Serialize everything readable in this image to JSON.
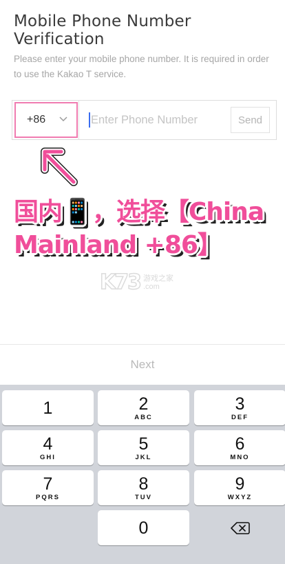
{
  "page": {
    "title": "Mobile Phone Number Verification",
    "description": "Please enter your mobile phone number. It is required in order to use the Kakao T service."
  },
  "phone_form": {
    "country_code": "+86",
    "placeholder": "Enter Phone Number",
    "send_label": "Send"
  },
  "annotation": {
    "line1": "国内📱，选择【China",
    "line2": "Mainland +86】",
    "color": "#f04e9a"
  },
  "watermark": {
    "brand": "K73",
    "sub1": "游戏之家",
    "sub2": ".com"
  },
  "footer": {
    "next_label": "Next"
  },
  "keyboard": {
    "keys": [
      {
        "digit": "1",
        "letters": ""
      },
      {
        "digit": "2",
        "letters": "ABC"
      },
      {
        "digit": "3",
        "letters": "DEF"
      },
      {
        "digit": "4",
        "letters": "GHI"
      },
      {
        "digit": "5",
        "letters": "JKL"
      },
      {
        "digit": "6",
        "letters": "MNO"
      },
      {
        "digit": "7",
        "letters": "PQRS"
      },
      {
        "digit": "8",
        "letters": "TUV"
      },
      {
        "digit": "9",
        "letters": "WXYZ"
      },
      {
        "digit": "0",
        "letters": ""
      }
    ],
    "delete_icon": "backspace-icon"
  },
  "colors": {
    "highlight_border": "#f07bb0",
    "caret": "#3b6df0",
    "keyboard_bg": "#d1d4da"
  }
}
